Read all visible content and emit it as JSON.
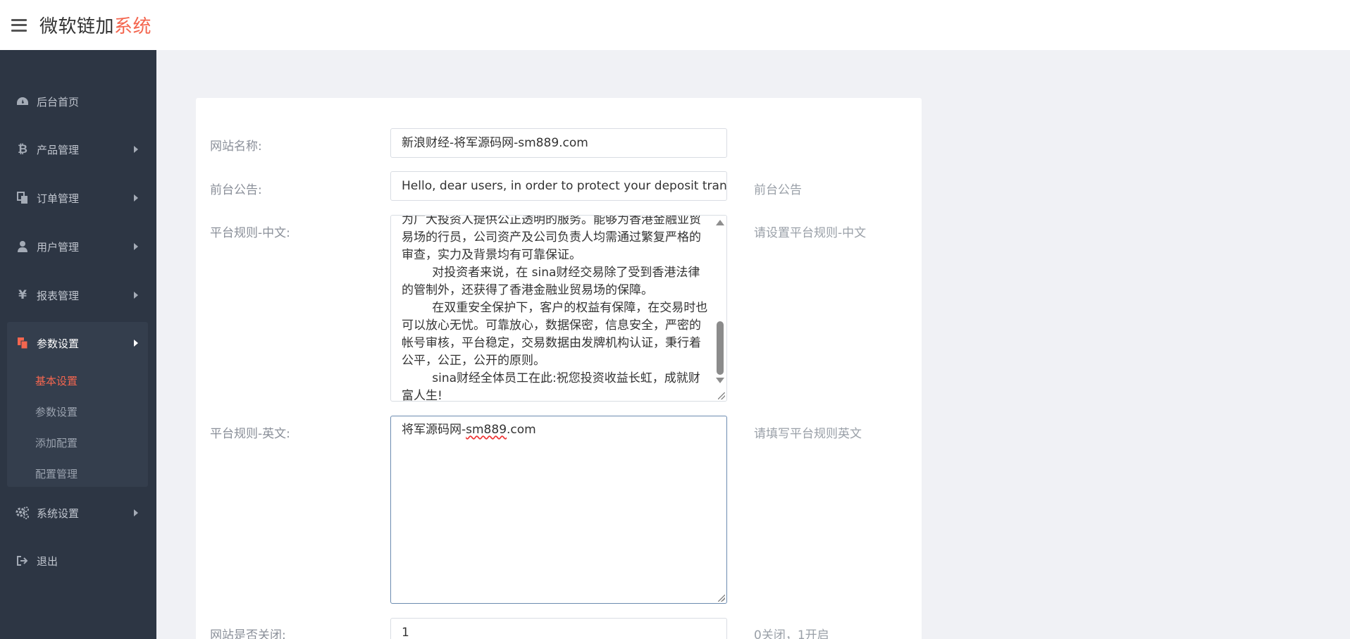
{
  "app": {
    "title_main": "微软链加",
    "title_accent": "系统"
  },
  "colors": {
    "accent": "#f4664f",
    "sidebar_bg": "#2d3644",
    "sidebar_group_bg": "#343e4d",
    "page_bg": "#f0f1f5"
  },
  "sidebar": {
    "items": [
      {
        "label": "后台首页",
        "icon": "dashboard-icon"
      },
      {
        "label": "产品管理",
        "icon": "bitcoin-icon"
      },
      {
        "label": "订单管理",
        "icon": "copy-icon"
      },
      {
        "label": "用户管理",
        "icon": "user-icon"
      },
      {
        "label": "报表管理",
        "icon": "yen-icon"
      },
      {
        "label": "参数设置",
        "icon": "copy-icon"
      },
      {
        "label": "系统设置",
        "icon": "gears-icon"
      },
      {
        "label": "退出",
        "icon": "sign-out-icon"
      }
    ],
    "subitems": [
      {
        "label": "基本设置",
        "active": true
      },
      {
        "label": "参数设置",
        "active": false
      },
      {
        "label": "添加配置",
        "active": false
      },
      {
        "label": "配置管理",
        "active": false
      }
    ]
  },
  "form": {
    "site_name": {
      "label": "网站名称:",
      "value": "新浪财经-将军源码网-sm889.com"
    },
    "notice": {
      "label": "前台公告:",
      "value": "Hello, dear users, in order to protect your deposit tran",
      "hint": "前台公告"
    },
    "rules_cn": {
      "label": "平台规则-中文:",
      "value": "为广大投资人提供公正透明的服务。能够为香港金融业贸易场的行员，公司资产及公司负责人均需通过繁复严格的审查，实力及背景均有可靠保证。\n        对投资者来说，在 sina财经交易除了受到香港法律的管制外，还获得了香港金融业贸易场的保障。\n        在双重安全保护下，客户的权益有保障，在交易时也可以放心无忧。可靠放心，数据保密，信息安全，严密的帐号审核，平台稳定，交易数据由发牌机构认证，秉行着公平，公正，公开的原则。\n        sina财经全体员工在此:祝您投资收益长虹，成就财富人生!",
      "hint": "请设置平台规则-中文"
    },
    "rules_en": {
      "label": "平台规则-英文:",
      "value_prefix": "将军源码网-",
      "value_marked": "sm889",
      "value_suffix": ".com",
      "hint": "请填写平台规则英文"
    },
    "site_closed": {
      "label": "网站是否关闭:",
      "value": "1",
      "hint": "0关闭，1开启"
    }
  }
}
